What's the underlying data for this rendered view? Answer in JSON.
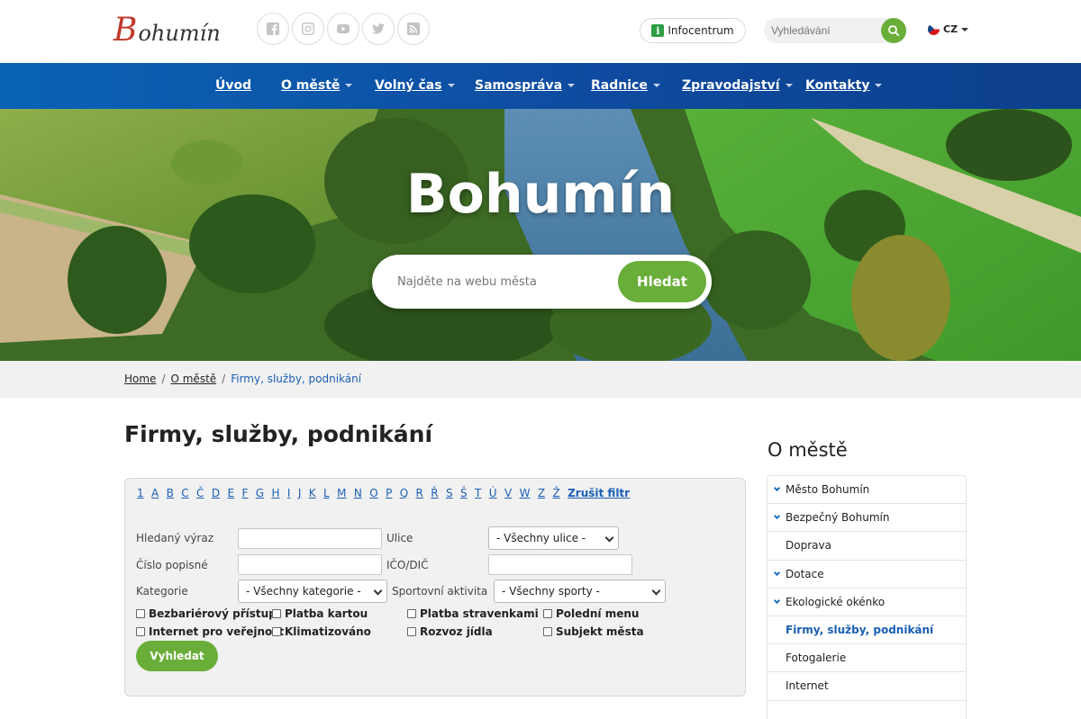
{
  "header": {
    "logo_b": "B",
    "logo_rest": "ohumín",
    "socials": [
      "facebook-icon",
      "instagram-icon",
      "youtube-icon",
      "twitter-icon",
      "rss-icon"
    ],
    "infocentrum": "Infocentrum",
    "search_placeholder": "Vyhledávání",
    "lang": "CZ"
  },
  "nav": {
    "items": [
      "Úvod",
      "O městě",
      "Volný čas",
      "Samospráva",
      "Radnice",
      "Zpravodajství",
      "Kontakty"
    ]
  },
  "hero": {
    "title": "Bohumín",
    "search_placeholder": "Najděte na webu města",
    "search_button": "Hledat"
  },
  "breadcrumb": {
    "items": [
      "Home",
      "O městě"
    ],
    "sep": "/",
    "current": "Firmy, služby, podnikání"
  },
  "main": {
    "title": "Firmy, služby, podnikání",
    "letters": [
      "1",
      "A",
      "B",
      "C",
      "Č",
      "D",
      "E",
      "F",
      "G",
      "H",
      "I",
      "J",
      "K",
      "L",
      "M",
      "N",
      "O",
      "P",
      "Q",
      "R",
      "Ř",
      "S",
      "Š",
      "T",
      "Ú",
      "V",
      "W",
      "Z",
      "Ž"
    ],
    "clear_filter": "Zrušit filtr",
    "labels": {
      "term": "Hledaný výraz",
      "street": "Ulice",
      "house_number": "Číslo popisné",
      "ico": "IČO/DIČ",
      "category": "Kategorie",
      "sport": "Sportovní aktivita"
    },
    "selects": {
      "street": "- Všechny ulice -",
      "category": "- Všechny kategorie -",
      "sport": "- Všechny sporty -"
    },
    "checkboxes": [
      "Bezbariérový přístup",
      "Platba kartou",
      "Platba stravenkami",
      "Polední menu",
      "Internet pro veřejnost",
      "Klimatizováno",
      "Rozvoz jídla",
      "Subjekt města"
    ],
    "search_button": "Vyhledat"
  },
  "sidebar": {
    "title": "O městě",
    "items": [
      {
        "label": "Město Bohumín",
        "expandable": true
      },
      {
        "label": "Bezpečný Bohumín",
        "expandable": true
      },
      {
        "label": "Doprava",
        "expandable": false
      },
      {
        "label": "Dotace",
        "expandable": true
      },
      {
        "label": "Ekologické okénko",
        "expandable": true
      },
      {
        "label": "Firmy, služby, podnikání",
        "expandable": false,
        "active": true
      },
      {
        "label": "Fotogalerie",
        "expandable": false
      },
      {
        "label": "Internet",
        "expandable": false
      },
      {
        "label": "",
        "expandable": false
      }
    ]
  },
  "colors": {
    "nav_blue": "#0e4ba0",
    "accent_green": "#6aae3a",
    "link_blue": "#1a5fb4"
  }
}
